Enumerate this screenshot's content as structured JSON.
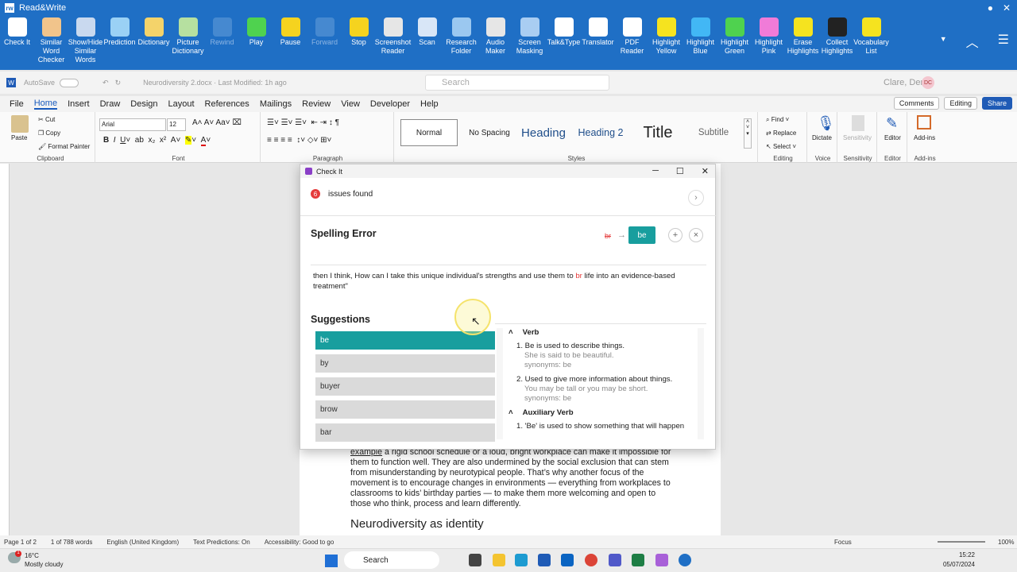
{
  "rw": {
    "title": "Read&Write",
    "tools": [
      {
        "label": "Check It",
        "icon": "check-icon",
        "color": "#ffffff",
        "dim": false
      },
      {
        "label": "Similar Word Checker",
        "icon": "ear-icon",
        "color": "#f1c48b",
        "dim": false
      },
      {
        "label": "Show/Hide Similar Words",
        "icon": "pencil-ear-icon",
        "color": "#c9d9ef",
        "dim": false
      },
      {
        "label": "Prediction",
        "icon": "crystal-ball-icon",
        "color": "#9ad1f5",
        "dim": false
      },
      {
        "label": "Dictionary",
        "icon": "book-icon",
        "color": "#f4d36a",
        "dim": false
      },
      {
        "label": "Picture Dictionary",
        "icon": "picture-icon",
        "color": "#b6e0a0",
        "dim": false
      },
      {
        "label": "Rewind",
        "icon": "rewind-icon",
        "color": "#6ea3dc",
        "dim": true
      },
      {
        "label": "Play",
        "icon": "play-icon",
        "color": "#4fd24f",
        "dim": false
      },
      {
        "label": "Pause",
        "icon": "pause-icon",
        "color": "#f5d31f",
        "dim": false
      },
      {
        "label": "Forward",
        "icon": "forward-icon",
        "color": "#6ea3dc",
        "dim": true
      },
      {
        "label": "Stop",
        "icon": "stop-icon",
        "color": "#f5d31f",
        "dim": false
      },
      {
        "label": "Screenshot Reader",
        "icon": "screenshot-icon",
        "color": "#e6e6e6",
        "dim": false
      },
      {
        "label": "Scan",
        "icon": "scan-icon",
        "color": "#d8e6f7",
        "dim": false
      },
      {
        "label": "Research Folder",
        "icon": "folder-icon",
        "color": "#9bc8f0",
        "dim": false
      },
      {
        "label": "Audio Maker",
        "icon": "audio-icon",
        "color": "#e6e6e6",
        "dim": false
      },
      {
        "label": "Screen Masking",
        "icon": "screen-icon",
        "color": "#a9cdf2",
        "dim": false
      },
      {
        "label": "Talk&Type",
        "icon": "talk-icon",
        "color": "#ffffff",
        "dim": false
      },
      {
        "label": "Translator",
        "icon": "translator-icon",
        "color": "#ffffff",
        "dim": false
      },
      {
        "label": "PDF Reader",
        "icon": "pdf-icon",
        "color": "#ffffff",
        "dim": false
      },
      {
        "label": "Highlight Yellow",
        "icon": "highlighter-yellow-icon",
        "color": "#f5e31f",
        "dim": false
      },
      {
        "label": "Highlight Blue",
        "icon": "highlighter-blue-icon",
        "color": "#42b7f5",
        "dim": false
      },
      {
        "label": "Highlight Green",
        "icon": "highlighter-green-icon",
        "color": "#4fd24f",
        "dim": false
      },
      {
        "label": "Highlight Pink",
        "icon": "highlighter-pink-icon",
        "color": "#f07bd8",
        "dim": false
      },
      {
        "label": "Erase Highlights",
        "icon": "eraser-icon",
        "color": "#f5e31f",
        "dim": false
      },
      {
        "label": "Collect Highlights",
        "icon": "collect-icon",
        "color": "#222222",
        "dim": false
      },
      {
        "label": "Vocabulary List",
        "icon": "vocab-icon",
        "color": "#f5e31f",
        "dim": false
      }
    ]
  },
  "word": {
    "autosave": "AutoSave",
    "filename": "Neurodiversity 2.docx · Last Modified: 1h ago",
    "search": "Search",
    "user": "Clare, Derek",
    "initials": "DC",
    "menu": [
      "File",
      "Home",
      "Insert",
      "Draw",
      "Design",
      "Layout",
      "References",
      "Mailings",
      "Review",
      "View",
      "Developer",
      "Help"
    ],
    "menu_active": "Home",
    "comments": "Comments",
    "editing": "Editing",
    "share": "Share",
    "clip": {
      "paste": "Paste",
      "cut": "Cut",
      "copy": "Copy",
      "painter": "Format Painter",
      "label": "Clipboard"
    },
    "font": {
      "name": "Arial",
      "size": "12",
      "label": "Font"
    },
    "paragraph_label": "Paragraph",
    "styles": [
      "Normal",
      "No Spacing",
      "Heading",
      "Heading 2",
      "Title",
      "Subtitle"
    ],
    "styles_label": "Styles",
    "editing_grp": {
      "find": "Find",
      "replace": "Replace",
      "select": "Select",
      "label": "Editing"
    },
    "voice": {
      "dictate": "Dictate",
      "label": "Voice"
    },
    "sensitivity": {
      "btn": "Sensitivity",
      "label": "Sensitivity"
    },
    "editor": {
      "btn": "Editor",
      "label": "Editor"
    },
    "addins": {
      "btn": "Add-ins",
      "label": "Add-ins"
    }
  },
  "document": {
    "paragraph_prefix": "example",
    "paragraph": " a rigid school schedule or a loud, bright workplace can make it impossible for them to function well. They are also undermined by the social exclusion that can stem from misunderstanding by neurotypical people. That’s why another focus of the movement is to encourage changes in environments — everything from workplaces to classrooms to kids’ birthday parties — to make them more welcoming and open to those who think, process and learn differently.",
    "heading": "Neurodiversity as identity"
  },
  "status": {
    "page": "Page 1 of 2",
    "words": "1 of 788 words",
    "lang": "English (United Kingdom)",
    "pred": "Text Predictions: On",
    "access": "Accessibility: Good to go",
    "focus": "Focus",
    "zoom": "100%"
  },
  "taskbar": {
    "temp": "16°C",
    "weather": "Mostly cloudy",
    "search": "Search",
    "time": "15:22",
    "date": "05/07/2024",
    "alert": "1"
  },
  "dialog": {
    "title": "Check It",
    "issues_count": "6",
    "issues_label": "issues found",
    "error_type": "Spelling Error",
    "original": "br",
    "replacement": "be",
    "sentence_before": "then I think, How can I take this unique individual's strengths and use them to ",
    "sentence_err": "br",
    "sentence_after": " life into an evidence-based treatment\"",
    "suggestions_title": "Suggestions",
    "suggestions": [
      "be",
      "by",
      "buyer",
      "brow",
      "bar"
    ],
    "defs": [
      {
        "pos": "Verb",
        "items": [
          {
            "text": "1. Be is used to describe things.",
            "example": "She is said to be beautiful.",
            "syn": "synonyms: be"
          },
          {
            "text": "2. Used to give more information about things.",
            "example": "You may be tall or you may be short.",
            "syn": "synonyms: be"
          }
        ]
      },
      {
        "pos": "Auxiliary Verb",
        "items": [
          {
            "text": "1. 'Be' is used to show something that will happen",
            "example": "",
            "syn": ""
          }
        ]
      }
    ]
  }
}
